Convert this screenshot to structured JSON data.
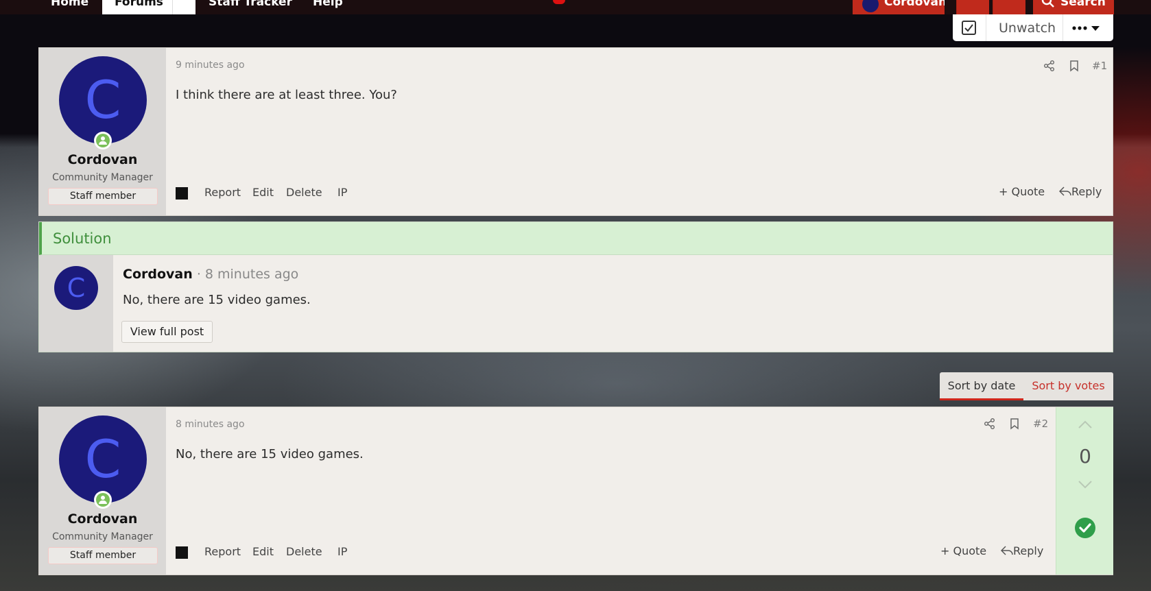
{
  "nav": {
    "tabs": [
      "Home",
      "Forums",
      "Staff Tracker",
      "Help"
    ],
    "user": "Cordovan",
    "search_label": "Search"
  },
  "watch": {
    "unwatch_label": "Unwatch",
    "more_label": "•••"
  },
  "posts": [
    {
      "number": "#1",
      "time": "9 minutes ago",
      "body": "I think there are at least three. You?",
      "author": {
        "avatar_letter": "C",
        "name": "Cordovan",
        "title": "Community Manager",
        "badge": "Staff member"
      },
      "actions": [
        "Report",
        "Edit",
        "Delete",
        "IP"
      ],
      "quote_label": "+ Quote",
      "reply_label": "Reply"
    },
    {
      "number": "#2",
      "time": "8 minutes ago",
      "body": "No, there are 15 video games.",
      "author": {
        "avatar_letter": "C",
        "name": "Cordovan",
        "title": "Community Manager",
        "badge": "Staff member"
      },
      "actions": [
        "Report",
        "Edit",
        "Delete",
        "IP"
      ],
      "quote_label": "+ Quote",
      "reply_label": "Reply",
      "vote_score": "0",
      "accepted": true
    }
  ],
  "solution": {
    "heading": "Solution",
    "avatar_letter": "C",
    "author": "Cordovan",
    "time": "· 8 minutes ago",
    "body": "No, there are 15 video games.",
    "button_label": "View full post"
  },
  "sort": {
    "by_date": "Sort by date",
    "by_votes": "Sort by votes",
    "active": "date"
  },
  "colors": {
    "accent": "#c02a1c",
    "solution_green": "#d7f0d3",
    "accept_green": "#2f9e4a",
    "avatar_bg": "#1b1a7a",
    "avatar_letter": "#4c5cf0"
  },
  "icons": [
    "user-online-icon",
    "share-icon",
    "bookmark-icon",
    "reply-arrow-icon",
    "checkbox-icon",
    "chevron-up-icon",
    "chevron-down-icon",
    "check-circle-icon",
    "search-icon",
    "caret-down-icon"
  ]
}
